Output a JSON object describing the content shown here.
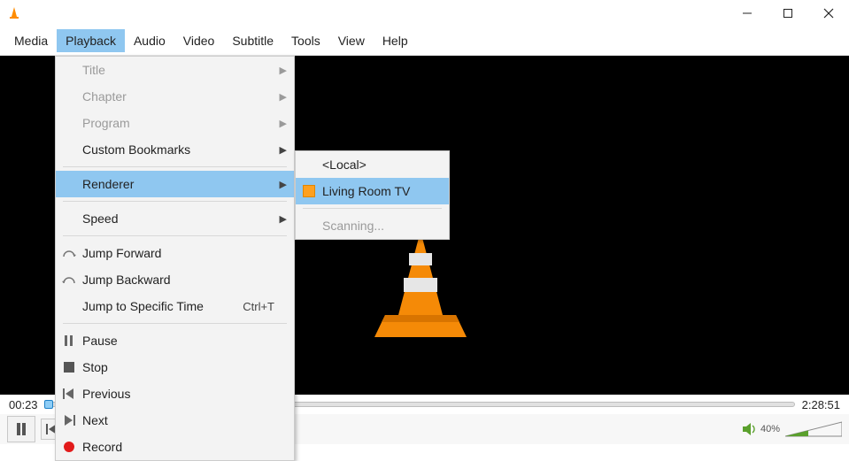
{
  "menubar": {
    "items": [
      "Media",
      "Playback",
      "Audio",
      "Video",
      "Subtitle",
      "Tools",
      "View",
      "Help"
    ],
    "open_index": 1
  },
  "playback_menu": {
    "title": "Title",
    "chapter": "Chapter",
    "program": "Program",
    "custom_bookmarks": "Custom Bookmarks",
    "renderer": "Renderer",
    "speed": "Speed",
    "jump_forward": "Jump Forward",
    "jump_backward": "Jump Backward",
    "jump_to_time": "Jump to Specific Time",
    "jump_to_time_sc": "Ctrl+T",
    "pause": "Pause",
    "stop": "Stop",
    "previous": "Previous",
    "next": "Next",
    "record": "Record"
  },
  "renderer_submenu": {
    "local": "<Local>",
    "option1": "Living Room TV",
    "scanning": "Scanning..."
  },
  "time": {
    "elapsed": "00:23",
    "total": "2:28:51"
  },
  "volume": {
    "percent": "40%"
  }
}
